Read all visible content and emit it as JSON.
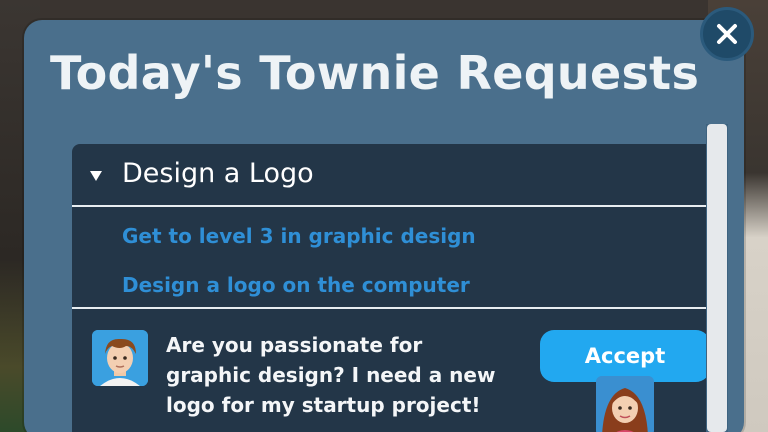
{
  "dialog": {
    "title": "Today's Townie Requests",
    "close_icon": "close-icon"
  },
  "request": {
    "title": "Design a Logo",
    "expanded": true,
    "tasks": [
      "Get to level 3 in graphic design",
      "Design a logo on the computer"
    ],
    "message": "Are you passionate for graphic design? I need a new logo for my startup project!",
    "accept_label": "Accept",
    "requester_avatar": "boy-avatar",
    "helper_avatar": "girl-avatar"
  },
  "colors": {
    "panel": "#4a6f8c",
    "list_bg": "#233648",
    "task_text": "#2f8fd6",
    "accept_button": "#22a8f0",
    "close_button": "#1f4a68"
  }
}
